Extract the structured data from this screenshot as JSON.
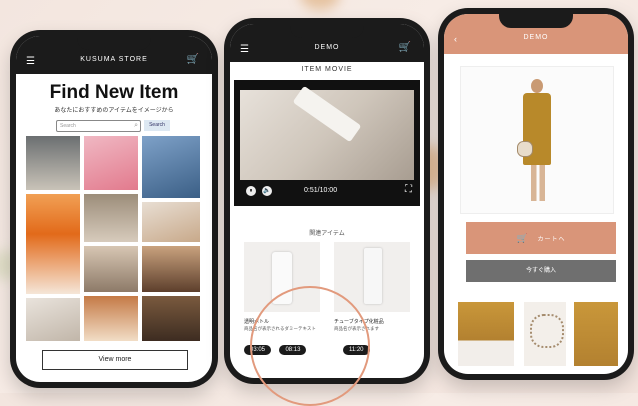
{
  "phone1": {
    "brand": "KUSUMA STORE",
    "headline": "Find New Item",
    "subhead": "あなたにおすすめのアイテムをイメージから",
    "search_placeholder": "Search",
    "search_button": "Search",
    "view_more": "View more"
  },
  "phone2": {
    "title": "DEMO",
    "section": "ITEM MOVIE",
    "time": "0:51/10:00",
    "related_title": "関連アイテム",
    "products": [
      {
        "name": "透明ボトル",
        "desc": "商品名が表示されるダミーテキスト"
      },
      {
        "name": "チューブタイプ化粧品",
        "desc": "商品名が表示されます"
      }
    ],
    "chips": [
      "03:05",
      "08:13",
      "11:20"
    ]
  },
  "phone3": {
    "title": "DEMO",
    "cta": "カートへ",
    "secondary": "今すぐ購入"
  },
  "colors": {
    "accent": "#d99579",
    "dark": "#1b1b1b",
    "gray": "#6f6f6f"
  }
}
